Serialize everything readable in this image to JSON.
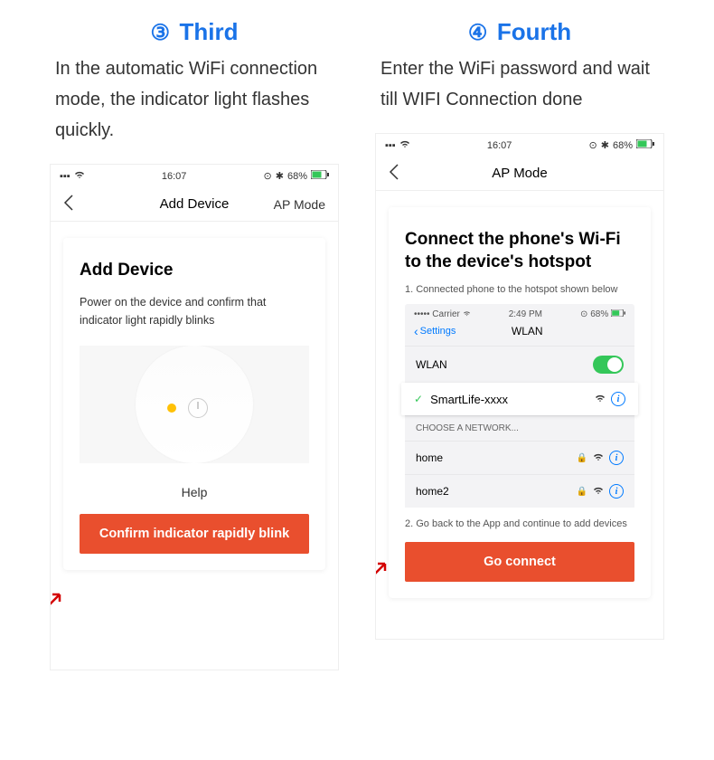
{
  "left": {
    "step_number": "③",
    "step_title": "Third",
    "step_desc": "In the automatic WiFi connection mode, the indicator light flashes quickly.",
    "status": {
      "time": "16:07",
      "battery": "68%"
    },
    "nav": {
      "title": "Add Device",
      "action": "AP Mode"
    },
    "card": {
      "title": "Add Device",
      "sub": "Power on the device and confirm that indicator light rapidly blinks",
      "help": "Help",
      "cta": "Confirm indicator rapidly blink"
    }
  },
  "right": {
    "step_number": "④",
    "step_title": "Fourth",
    "step_desc": "Enter the WiFi password and wait till WIFI Connection done",
    "status": {
      "time": "16:07",
      "battery": "68%"
    },
    "nav": {
      "title": "AP Mode"
    },
    "card": {
      "title": "Connect the phone's Wi-Fi to the device's hotspot",
      "step1": "1. Connected phone to the hotspot shown below",
      "step2": "2. Go back to the App and continue to add devices",
      "wlan": {
        "carrier": "••••• Carrier",
        "time": "2:49 PM",
        "battery": "68%",
        "settings": "Settings",
        "title": "WLAN",
        "toggle_label": "WLAN",
        "connected": "SmartLife-xxxx",
        "choose": "CHOOSE A NETWORK...",
        "networks": [
          "home",
          "home2"
        ]
      },
      "cta": "Go connect"
    }
  }
}
